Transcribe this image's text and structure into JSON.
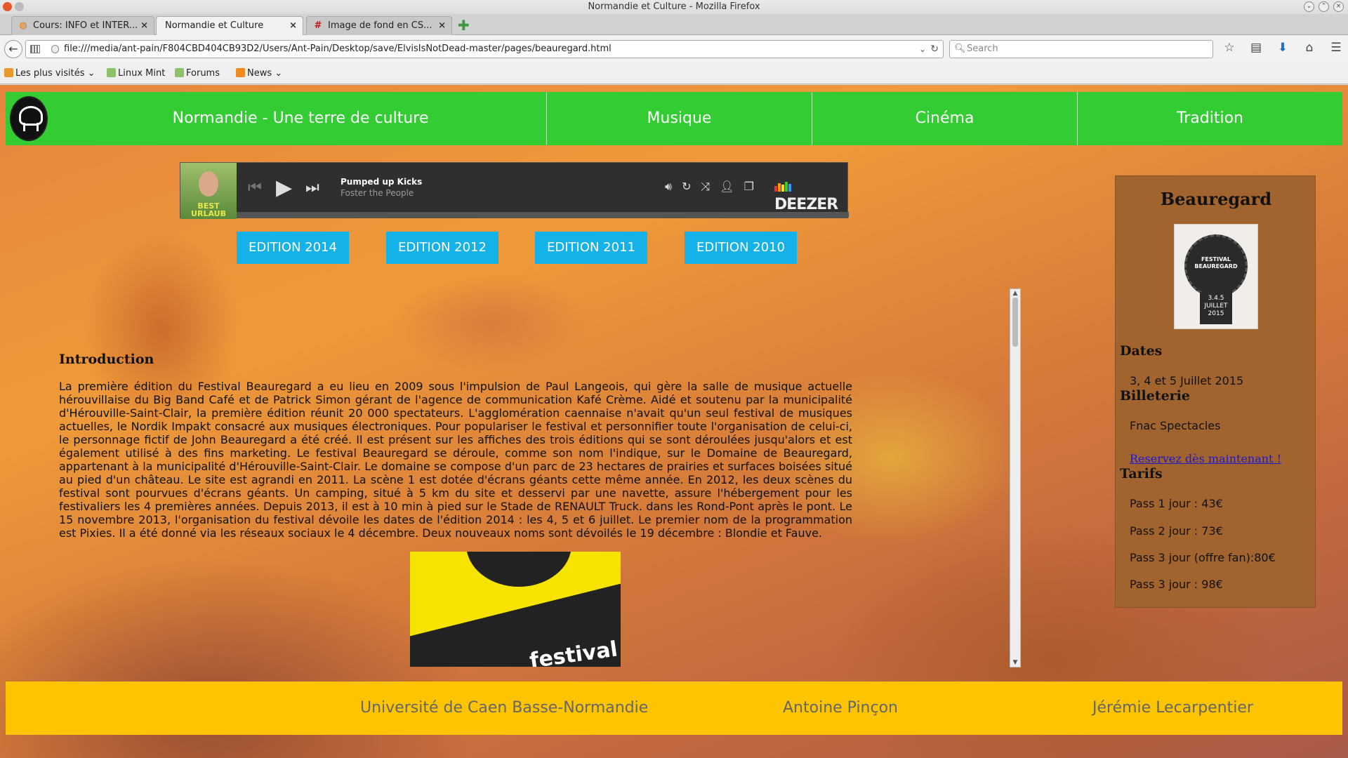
{
  "window": {
    "title": "Normandie et Culture - Mozilla Firefox"
  },
  "tabs": [
    {
      "label": "Cours: INFO et INTER..."
    },
    {
      "label": "Normandie et Culture"
    },
    {
      "label": "Image de fond en CS..."
    }
  ],
  "navbar": {
    "url": "file:///media/ant-pain/F804CBD404CB93D2/Users/Ant-Pain/Desktop/save/ElvisIsNotDead-master/pages/beauregard.html",
    "search_placeholder": "Search"
  },
  "bookmarks": [
    {
      "label": "Les plus visités"
    },
    {
      "label": "Linux Mint"
    },
    {
      "label": "Forums"
    },
    {
      "label": "News"
    }
  ],
  "site_nav": {
    "items": [
      {
        "label": "Normandie - Une terre de culture"
      },
      {
        "label": "Musique"
      },
      {
        "label": "Cinéma"
      },
      {
        "label": "Tradition"
      }
    ]
  },
  "player": {
    "track": "Pumped up Kicks",
    "artist": "Foster the People",
    "brand": "DEEZER",
    "cover_text": "BEST URLAUB"
  },
  "editions": [
    {
      "label": "EDITION 2014"
    },
    {
      "label": "EDITION 2012"
    },
    {
      "label": "EDITION 2011"
    },
    {
      "label": "EDITION 2010"
    }
  ],
  "article": {
    "heading": "Introduction",
    "body": "La première édition du Festival Beauregard a eu lieu en 2009 sous l'impulsion de Paul Langeois, qui gère la salle de musique actuelle hérouvillaise du Big Band Café et de Patrick Simon gérant de l'agence de communication Kafé Crème. Aidé et soutenu par la municipalité d'Hérouville-Saint-Clair, la première édition réunit 20 000 spectateurs. L'agglomération caennaise n'avait qu'un seul festival de musiques actuelles, le Nordik Impakt consacré aux musiques électroniques. Pour populariser le festival et personnifier toute l'organisation de celui-ci, le personnage fictif de John Beauregard a été créé. Il est présent sur les affiches des trois éditions qui se sont déroulées jusqu'alors et est également utilisé à des fins marketing. Le festival Beauregard se déroule, comme son nom l'indique, sur le Domaine de Beauregard, appartenant à la municipalité d'Hérouville-Saint-Clair. Le domaine se compose d'un parc de 23 hectares de prairies et surfaces boisées situé au pied d'un château. Le site est agrandi en 2011. La scène 1 est dotée d'écrans géants cette même année. En 2012, les deux scènes du festival sont pourvues d'écrans géants. Un camping, situé à 5 km du site et desservi par une navette, assure l'hébergement pour les festivaliers les 4 premières années. Depuis 2013, il est à 10 min à pied sur le Stade de RENAULT Truck. dans les Rond-Pont après le pont. Le 15 novembre 2013, l'organisation du festival dévoile les dates de l'édition 2014 : les 4, 5 et 6 juillet. Le premier nom de la programmation est Pixies. Il a été donné via les réseaux sociaux le 4 décembre. Deux nouveaux noms sont dévoilés le 19 décembre : Blondie et Fauve.",
    "poster_text": "festival"
  },
  "sidebar": {
    "title": "Beauregard",
    "badge_line1": "FESTIVAL BEAUREGARD",
    "badge_line2": "3.4.5 JUILLET 2015",
    "dates_heading": "Dates",
    "dates_text": "3, 4 et 5 Juillet 2015",
    "billetterie_heading": "Billeterie",
    "billetterie_text": "Fnac Spectacles",
    "reserve_link": "Reservez dès maintenant !",
    "tarifs_heading": "Tarifs",
    "tarifs": [
      "Pass 1 jour : 43€",
      "Pass 2 jour : 73€",
      "Pass 3 jour (offre fan):80€",
      "Pass 3 jour : 98€"
    ]
  },
  "footer": {
    "items": [
      {
        "label": "Université de Caen Basse-Normandie"
      },
      {
        "label": "Antoine Pinçon"
      },
      {
        "label": "Jérémie Lecarpentier"
      }
    ]
  },
  "colors": {
    "nav_green": "#33cc33",
    "edition_blue": "#14b2e8",
    "sidebar_brown": "#a1642e",
    "footer_yellow": "#ffc400",
    "link_blue": "#1a1ad0"
  }
}
